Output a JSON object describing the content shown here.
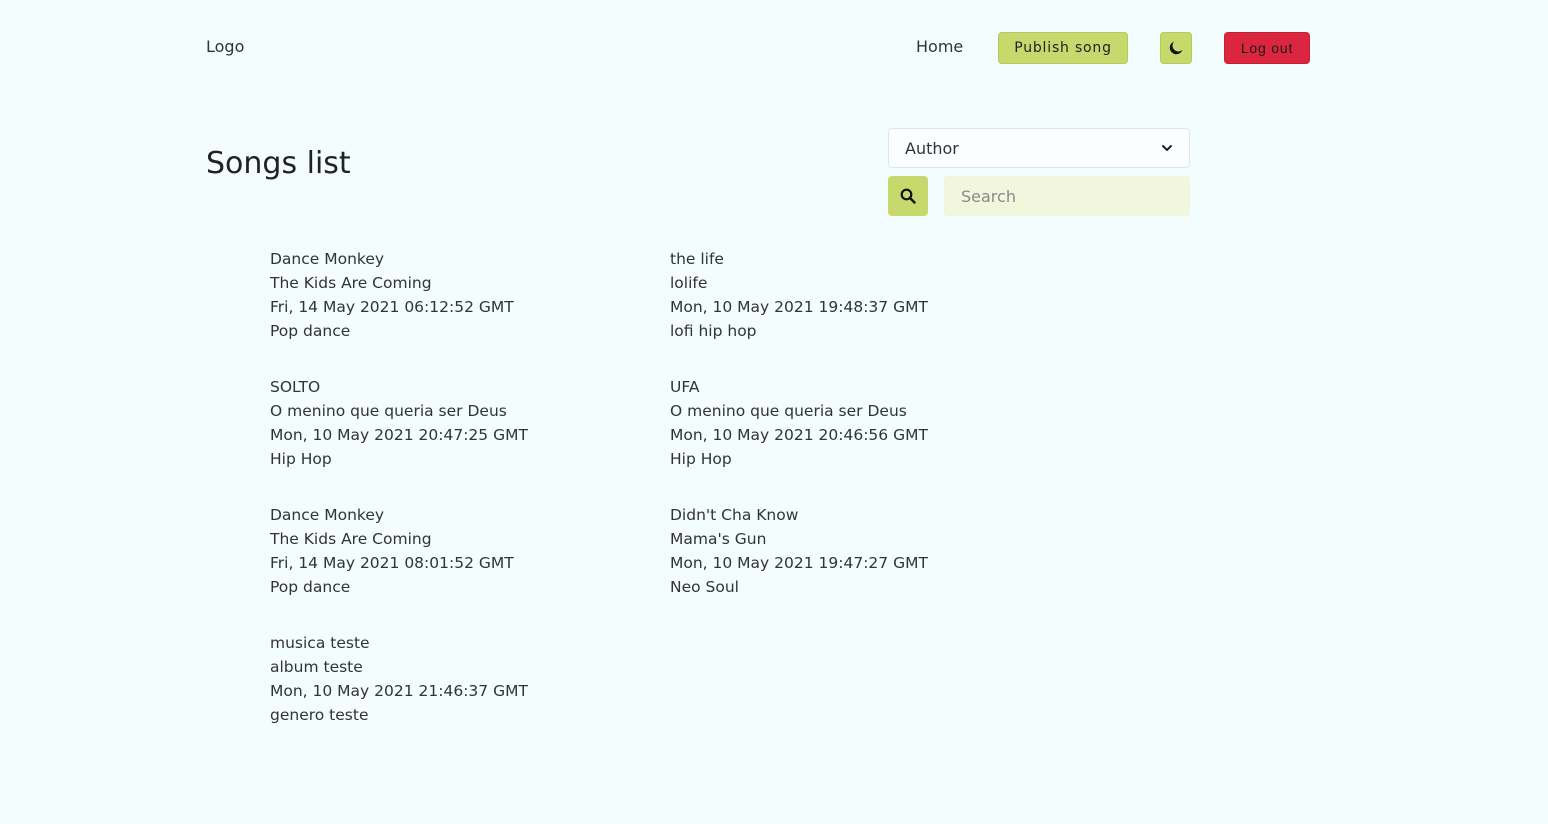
{
  "header": {
    "logo": "Logo",
    "home": "Home",
    "publish": "Publish song",
    "theme_icon": "moon-icon",
    "logout": "Log out"
  },
  "title": "Songs list",
  "filter": {
    "selected": "Author",
    "options": [
      "Author"
    ],
    "search_placeholder": "Search",
    "search_value": ""
  },
  "songs": [
    {
      "name": "Dance Monkey",
      "album": "The Kids Are Coming",
      "date": "Fri, 14 May 2021 06:12:52 GMT",
      "genre": "Pop dance"
    },
    {
      "name": "the life",
      "album": "lolife",
      "date": "Mon, 10 May 2021 19:48:37 GMT",
      "genre": "lofi hip hop"
    },
    {
      "name": "SOLTO",
      "album": "O menino que queria ser Deus",
      "date": "Mon, 10 May 2021 20:47:25 GMT",
      "genre": "Hip Hop"
    },
    {
      "name": "UFA",
      "album": "O menino que queria ser Deus",
      "date": "Mon, 10 May 2021 20:46:56 GMT",
      "genre": "Hip Hop"
    },
    {
      "name": "Dance Monkey",
      "album": "The Kids Are Coming",
      "date": "Fri, 14 May 2021 08:01:52 GMT",
      "genre": "Pop dance"
    },
    {
      "name": "Didn't Cha Know",
      "album": "Mama's Gun",
      "date": "Mon, 10 May 2021 19:47:27 GMT",
      "genre": "Neo Soul"
    },
    {
      "name": "musica teste",
      "album": "album teste",
      "date": "Mon, 10 May 2021 21:46:37 GMT",
      "genre": "genero teste"
    }
  ],
  "colors": {
    "background": "#f3fdfd",
    "accent": "#c7d86c",
    "danger": "#dc2640",
    "search_bg": "#f2f6dd"
  }
}
